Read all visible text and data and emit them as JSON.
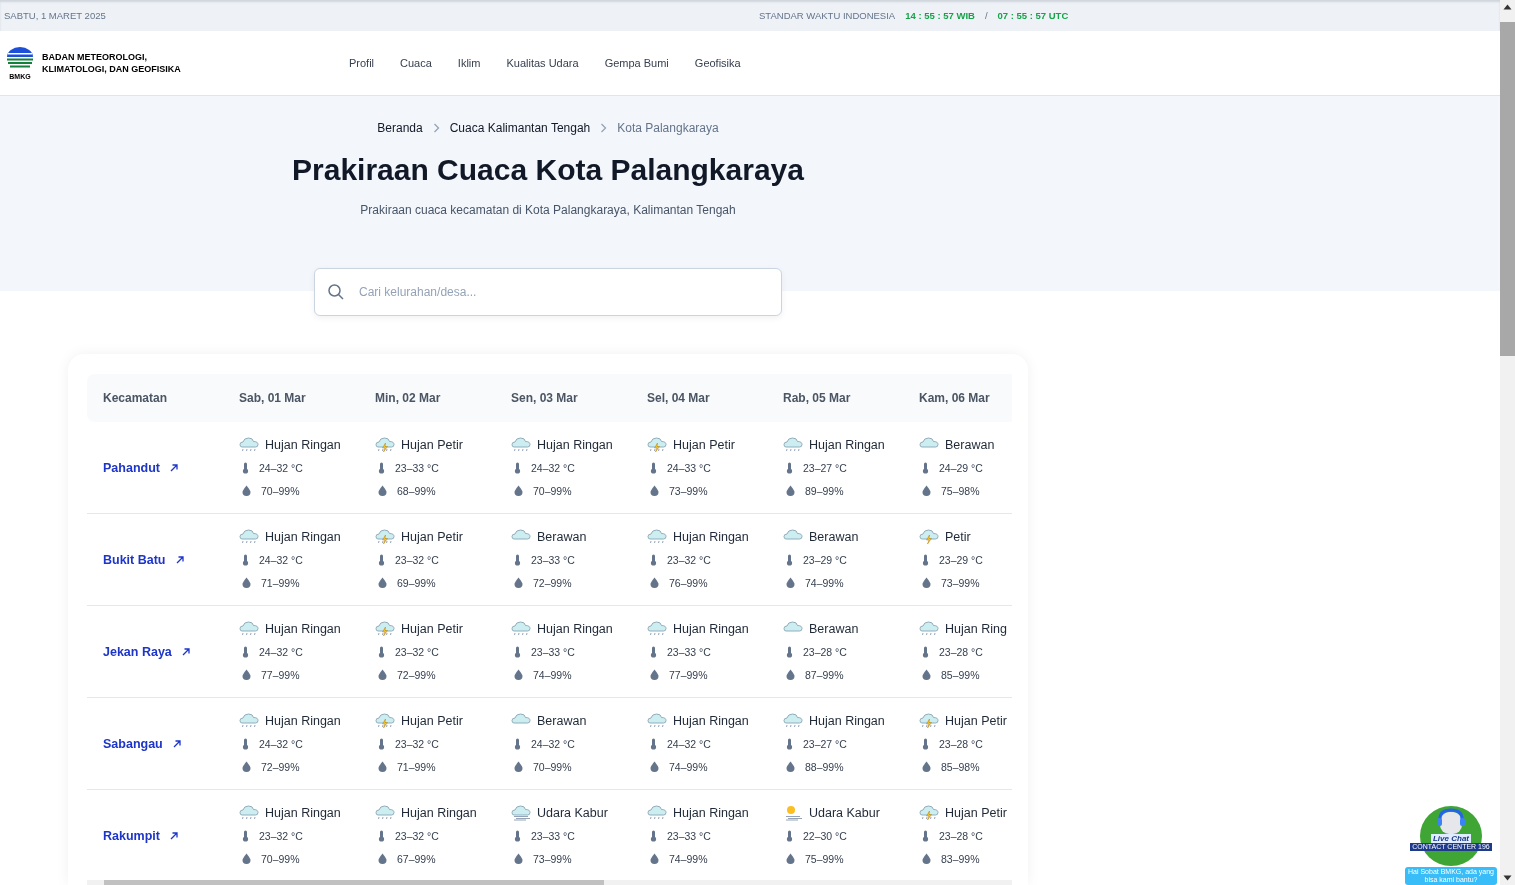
{
  "top_bar": {
    "date": "SABTU, 1 MARET 2025",
    "time_label": "STANDAR WAKTU INDONESIA",
    "local_time": "14 : 55 : 57 WIB",
    "separator": "/",
    "utc_time": "07 : 55 : 57 UTC"
  },
  "header": {
    "logo_text": "BMKG",
    "agency_name": "BADAN METEOROLOGI, KLIMATOLOGI, DAN GEOFISIKA",
    "nav": [
      "Profil",
      "Cuaca",
      "Iklim",
      "Kualitas Udara",
      "Gempa Bumi",
      "Geofisika"
    ]
  },
  "breadcrumb": [
    "Beranda",
    "Cuaca Kalimantan Tengah",
    "Kota Palangkaraya"
  ],
  "title": "Prakiraan Cuaca Kota Palangkaraya",
  "subtitle": "Prakiraan cuaca kecamatan di Kota Palangkaraya, Kalimantan Tengah",
  "search": {
    "placeholder": "Cari kelurahan/desa..."
  },
  "table": {
    "columns": [
      "Kecamatan",
      "Sab, 01 Mar",
      "Min, 02 Mar",
      "Sen, 03 Mar",
      "Sel, 04 Mar",
      "Rab, 05 Mar",
      "Kam, 06 Mar"
    ],
    "rows": [
      {
        "district": "Pahandut",
        "forecasts": [
          {
            "kind": "rain",
            "condition": "Hujan Ringan",
            "temp": "24–32 °C",
            "humidity": "70–99%"
          },
          {
            "kind": "thunder",
            "condition": "Hujan Petir",
            "temp": "23–33 °C",
            "humidity": "68–99%"
          },
          {
            "kind": "rain",
            "condition": "Hujan Ringan",
            "temp": "24–32 °C",
            "humidity": "70–99%"
          },
          {
            "kind": "thunder",
            "condition": "Hujan Petir",
            "temp": "24–33 °C",
            "humidity": "73–99%"
          },
          {
            "kind": "rain",
            "condition": "Hujan Ringan",
            "temp": "23–27 °C",
            "humidity": "89–99%"
          },
          {
            "kind": "cloudy",
            "condition": "Berawan",
            "temp": "24–29 °C",
            "humidity": "75–98%"
          }
        ]
      },
      {
        "district": "Bukit Batu",
        "forecasts": [
          {
            "kind": "rain",
            "condition": "Hujan Ringan",
            "temp": "24–32 °C",
            "humidity": "71–99%"
          },
          {
            "kind": "thunder",
            "condition": "Hujan Petir",
            "temp": "23–32 °C",
            "humidity": "69–99%"
          },
          {
            "kind": "cloudy",
            "condition": "Berawan",
            "temp": "23–33 °C",
            "humidity": "72–99%"
          },
          {
            "kind": "rain",
            "condition": "Hujan Ringan",
            "temp": "23–32 °C",
            "humidity": "76–99%"
          },
          {
            "kind": "cloudy",
            "condition": "Berawan",
            "temp": "23–29 °C",
            "humidity": "74–99%"
          },
          {
            "kind": "lightning",
            "condition": "Petir",
            "temp": "23–29 °C",
            "humidity": "73–99%"
          }
        ]
      },
      {
        "district": "Jekan Raya",
        "forecasts": [
          {
            "kind": "rain",
            "condition": "Hujan Ringan",
            "temp": "24–32 °C",
            "humidity": "77–99%"
          },
          {
            "kind": "thunder",
            "condition": "Hujan Petir",
            "temp": "23–32 °C",
            "humidity": "72–99%"
          },
          {
            "kind": "rain",
            "condition": "Hujan Ringan",
            "temp": "23–33 °C",
            "humidity": "74–99%"
          },
          {
            "kind": "rain",
            "condition": "Hujan Ringan",
            "temp": "23–33 °C",
            "humidity": "77–99%"
          },
          {
            "kind": "cloudy",
            "condition": "Berawan",
            "temp": "23–28 °C",
            "humidity": "87–99%"
          },
          {
            "kind": "rain",
            "condition": "Hujan Ring",
            "temp": "23–28 °C",
            "humidity": "85–99%"
          }
        ]
      },
      {
        "district": "Sabangau",
        "forecasts": [
          {
            "kind": "rain",
            "condition": "Hujan Ringan",
            "temp": "24–32 °C",
            "humidity": "72–99%"
          },
          {
            "kind": "thunder",
            "condition": "Hujan Petir",
            "temp": "23–32 °C",
            "humidity": "71–99%"
          },
          {
            "kind": "cloudy",
            "condition": "Berawan",
            "temp": "24–32 °C",
            "humidity": "70–99%"
          },
          {
            "kind": "rain",
            "condition": "Hujan Ringan",
            "temp": "24–32 °C",
            "humidity": "74–99%"
          },
          {
            "kind": "rain",
            "condition": "Hujan Ringan",
            "temp": "23–27 °C",
            "humidity": "88–99%"
          },
          {
            "kind": "thunder",
            "condition": "Hujan Petir",
            "temp": "23–28 °C",
            "humidity": "85–98%"
          }
        ]
      },
      {
        "district": "Rakumpit",
        "forecasts": [
          {
            "kind": "rain",
            "condition": "Hujan Ringan",
            "temp": "23–32 °C",
            "humidity": "70–99%"
          },
          {
            "kind": "rain",
            "condition": "Hujan Ringan",
            "temp": "23–32 °C",
            "humidity": "67–99%"
          },
          {
            "kind": "haze",
            "condition": "Udara Kabur",
            "temp": "23–33 °C",
            "humidity": "73–99%"
          },
          {
            "kind": "rain",
            "condition": "Hujan Ringan",
            "temp": "23–33 °C",
            "humidity": "74–99%"
          },
          {
            "kind": "haze-sun",
            "condition": "Udara Kabur",
            "temp": "22–30 °C",
            "humidity": "75–99%"
          },
          {
            "kind": "thunder",
            "condition": "Hujan Petir",
            "temp": "23–28 °C",
            "humidity": "83–99%"
          }
        ]
      }
    ]
  },
  "live_chat": {
    "title": "Live Chat",
    "subtitle": "CONTACT CENTER 196",
    "message": "Hai Sobat BMKG, ada yang bisa kami bantu?"
  }
}
